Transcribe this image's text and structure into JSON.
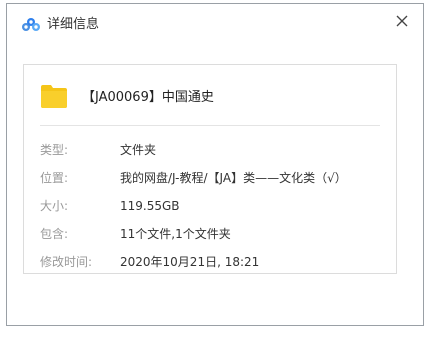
{
  "dialog": {
    "title": "详细信息",
    "close_icon": "close-icon",
    "app_icon": "cloud-icon"
  },
  "file": {
    "icon": "folder-icon",
    "icon_color": "#f5c518",
    "name": "【JA00069】中国通史"
  },
  "properties": [
    {
      "label": "类型:",
      "value": "文件夹"
    },
    {
      "label": "位置:",
      "value": "我的网盘/J-教程/【JA】类——文化类（√）"
    },
    {
      "label": "大小:",
      "value": "119.55GB"
    },
    {
      "label": "包含:",
      "value": "11个文件,1个文件夹"
    },
    {
      "label": "修改时间:",
      "value": "2020年10月21日, 18:21"
    }
  ]
}
